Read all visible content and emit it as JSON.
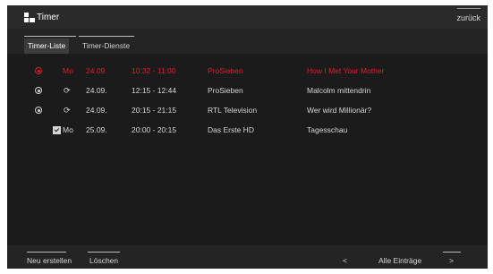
{
  "header": {
    "title": "Timer",
    "back_label": "zurück"
  },
  "tabs": [
    {
      "label": "Timer-Liste",
      "active": true
    },
    {
      "label": "Timer-Dienste",
      "active": false
    }
  ],
  "rows": [
    {
      "day": "Mo",
      "date": "24.09.",
      "time": "10:32 - 11:00",
      "channel": "ProSieben",
      "title": "How I Met Your Mother",
      "status": "recording-active",
      "icon": "record-icon"
    },
    {
      "day": "",
      "date": "24.09.",
      "time": "12:15 - 12:44",
      "channel": "ProSieben",
      "title": "Malcolm mittendrin",
      "status": "scheduled-repeat",
      "icon": "repeat-icon"
    },
    {
      "day": "",
      "date": "24.09.",
      "time": "20:15 - 21:15",
      "channel": "RTL Television",
      "title": "Wer wird Millionär?",
      "status": "scheduled-repeat",
      "icon": "repeat-icon"
    },
    {
      "day": "Mo",
      "date": "25.09.",
      "time": "20:00 - 20:15",
      "channel": "Das Erste HD",
      "title": "Tagesschau",
      "status": "checked",
      "icon": "checkbox-icon"
    }
  ],
  "footer": {
    "new_label": "Neu erstellen",
    "delete_label": "Löschen",
    "prev_label": "<",
    "filter_label": "Alle Einträge",
    "next_label": ">"
  },
  "colors": {
    "highlight": "#e01e2a",
    "background": "#1b1b1b",
    "text": "#d6d6d6"
  }
}
